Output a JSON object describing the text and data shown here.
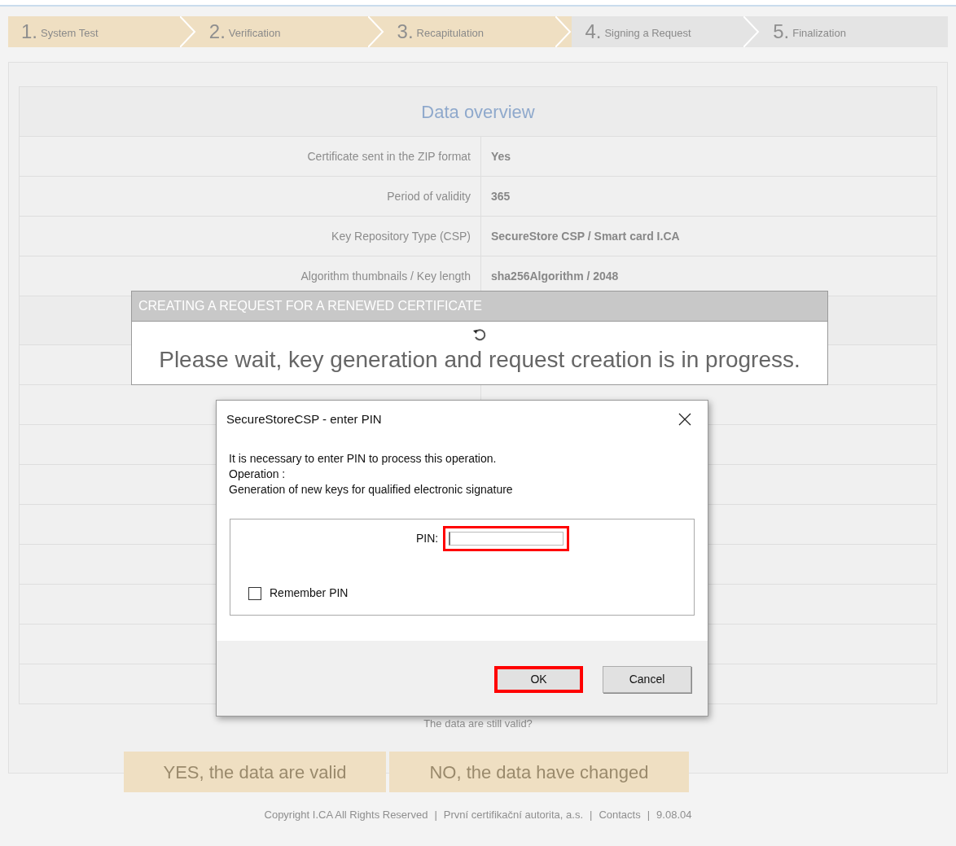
{
  "steps": [
    {
      "number": "1.",
      "label": "System Test",
      "completed": true
    },
    {
      "number": "2.",
      "label": "Verification",
      "completed": true
    },
    {
      "number": "3.",
      "label": "Recapitulation",
      "completed": true
    },
    {
      "number": "4.",
      "label": "Signing a Request",
      "completed": false
    },
    {
      "number": "5.",
      "label": "Finalization",
      "completed": false
    }
  ],
  "overview": {
    "title": "Data overview",
    "rows": [
      {
        "label": "Certificate sent in the ZIP format",
        "value": "Yes"
      },
      {
        "label": "Period of validity",
        "value": "365"
      },
      {
        "label": "Key Repository Type (CSP)",
        "value": "SecureStore CSP / Smart card I.CA"
      },
      {
        "label": "Algorithm thumbnails / Key length",
        "value": "sha256Algorithm / 2048"
      }
    ]
  },
  "question": "The data are still valid?",
  "answer_buttons": [
    "YES, the data are valid",
    "NO, the data have changed"
  ],
  "footer": {
    "separator": "|",
    "items": [
      "Copyright I.CA All Rights Reserved",
      "První certifikační autorita, a.s.",
      "Contacts",
      "9.08.04"
    ]
  },
  "progress": {
    "title": "CREATING A REQUEST FOR A RENEWED CERTIFICATE",
    "message": "Please wait, key generation and request creation is in progress."
  },
  "pin_dialog": {
    "title": "SecureStoreCSP - enter PIN",
    "lines": [
      "It is necessary to enter PIN to process this operation.",
      "Operation :",
      "Generation of new keys for qualified electronic signature"
    ],
    "pin_label": "PIN:",
    "pin_highlighted": true,
    "remember": {
      "label": "Remember PIN",
      "checked": false
    },
    "buttons": [
      {
        "label": "OK",
        "highlighted": true
      },
      {
        "label": "Cancel",
        "highlighted": false
      }
    ]
  }
}
